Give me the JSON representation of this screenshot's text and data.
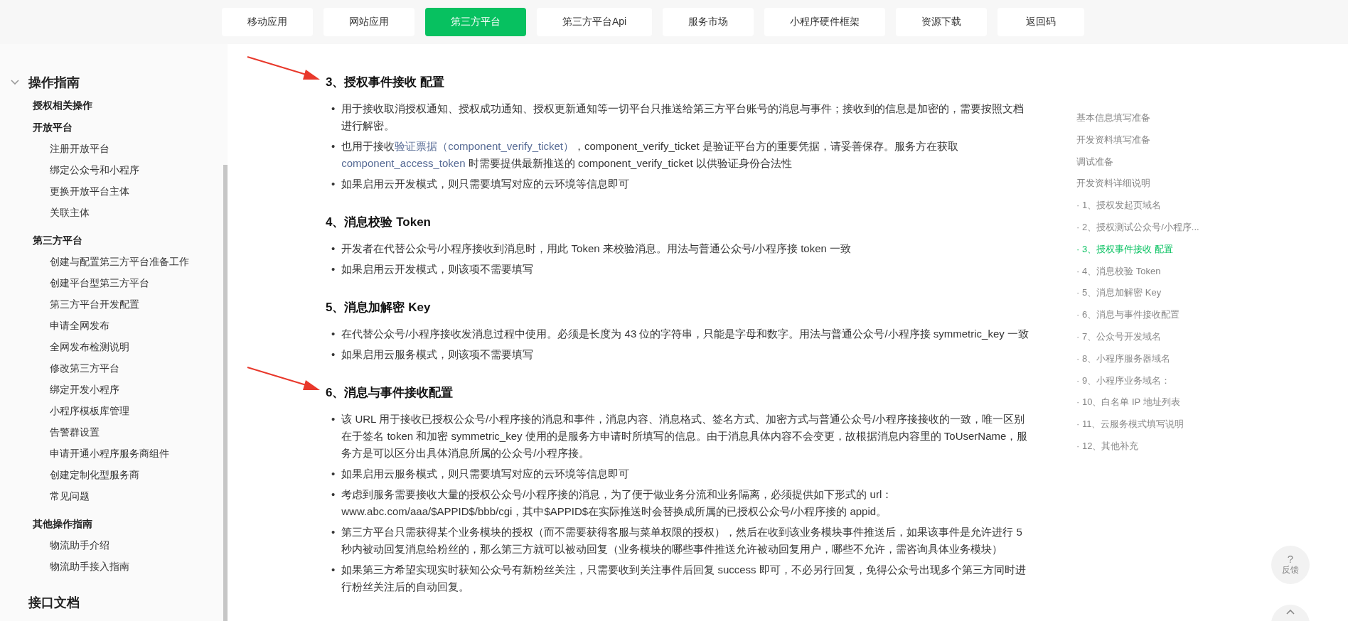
{
  "nav": [
    {
      "label": "移动应用",
      "selected": false
    },
    {
      "label": "网站应用",
      "selected": false
    },
    {
      "label": "第三方平台",
      "selected": true
    },
    {
      "label": "第三方平台Api",
      "selected": false
    },
    {
      "label": "服务市场",
      "selected": false
    },
    {
      "label": "小程序硬件框架",
      "selected": false
    },
    {
      "label": "资源下载",
      "selected": false
    },
    {
      "label": "返回码",
      "selected": false
    }
  ],
  "sidebar": {
    "sections": [
      {
        "title": "操作指南",
        "expanded": true,
        "groups": [
          {
            "title": "授权相关操作"
          },
          {
            "title": "开放平台",
            "items": [
              "注册开放平台",
              "绑定公众号和小程序",
              "更换开放平台主体",
              "关联主体"
            ]
          },
          {
            "title": "第三方平台",
            "items": [
              "创建与配置第三方平台准备工作",
              "创建平台型第三方平台",
              "第三方平台开发配置",
              "申请全网发布",
              "全网发布检测说明",
              "修改第三方平台",
              "绑定开发小程序",
              "小程序模板库管理",
              "告警群设置",
              "申请开通小程序服务商组件",
              "创建定制化型服务商",
              "常见问题"
            ]
          },
          {
            "title": "其他操作指南",
            "items": [
              "物流助手介绍",
              "物流助手接入指南"
            ]
          }
        ]
      }
    ],
    "footer_section": "接口文档"
  },
  "content": {
    "sections": [
      {
        "heading": "3、授权事件接收 配置",
        "arrow": true,
        "bullets": [
          {
            "marker": "•",
            "parts": [
              {
                "text": "用于接收取消授权通知、授权成功通知、授权更新通知等一切平台只推送给第三方平台账号的消息与事件；接收到的信息是加密的，需要按照文档进行解密。",
                "link": false
              }
            ]
          },
          {
            "marker": "•",
            "parts": [
              {
                "text": "也用于接收",
                "link": false
              },
              {
                "text": "验证票据（component_verify_ticket）",
                "link": true
              },
              {
                "text": "，component_verify_ticket 是验证平台方的重要凭据，请妥善保存。服务方在获取 ",
                "link": false
              },
              {
                "text": "component_access_token",
                "link": true
              },
              {
                "text": " 时需要提供最新推送的 component_verify_ticket 以供验证身份合法性",
                "link": false
              }
            ]
          },
          {
            "marker": "•",
            "parts": [
              {
                "text": "如果启用云开发模式，则只需要填写对应的云环境等信息即可",
                "link": false
              }
            ]
          }
        ]
      },
      {
        "heading": "4、消息校验 Token",
        "arrow": false,
        "bullets": [
          {
            "marker": "•",
            "parts": [
              {
                "text": "开发者在代替公众号/小程序接收到消息时，用此 Token 来校验消息。用法与普通公众号/小程序接 token 一致",
                "link": false
              }
            ]
          },
          {
            "marker": "•",
            "parts": [
              {
                "text": "如果启用云开发模式，则该项不需要填写",
                "link": false
              }
            ]
          }
        ]
      },
      {
        "heading": "5、消息加解密 Key",
        "arrow": false,
        "bullets": [
          {
            "marker": "•",
            "parts": [
              {
                "text": "在代替公众号/小程序接收发消息过程中使用。必须是长度为 43 位的字符串，只能是字母和数字。用法与普通公众号/小程序接 symmetric_key 一致",
                "link": false
              }
            ]
          },
          {
            "marker": "•",
            "parts": [
              {
                "text": "如果启用云服务模式，则该项不需要填写",
                "link": false
              }
            ]
          }
        ]
      },
      {
        "heading": "6、消息与事件接收配置",
        "arrow": true,
        "bullets": [
          {
            "marker": "•",
            "parts": [
              {
                "text": "该 URL 用于接收已授权公众号/小程序接的消息和事件，消息内容、消息格式、签名方式、加密方式与普通公众号/小程序接接收的一致，唯一区别在于签名 token 和加密 symmetric_key 使用的是服务方申请时所填写的信息。由于消息具体内容不会变更，故根据消息内容里的 ToUserName，服务方是可以区分出具体消息所属的公众号/小程序接。",
                "link": false
              }
            ]
          },
          {
            "marker": "•",
            "parts": [
              {
                "text": "如果启用云服务模式，则只需要填写对应的云环境等信息即可",
                "link": false
              }
            ]
          },
          {
            "marker": "•",
            "parts": [
              {
                "text": "考虑到服务需要接收大量的授权公众号/小程序接的消息，为了便于做业务分流和业务隔离，必须提供如下形式的 url：www.abc.com/aaa/$APPID$/bbb/cgi，其中$APPID$在实际推送时会替换成所属的已授权公众号/小程序接的 appid。",
                "link": false
              }
            ]
          },
          {
            "marker": "•",
            "parts": [
              {
                "text": "第三方平台只需获得某个业务模块的授权（而不需要获得客服与菜单权限的授权），然后在收到该业务模块事件推送后，如果该事件是允许进行 5 秒内被动回复消息给粉丝的，那么第三方就可以被动回复（业务模块的哪些事件推送允许被动回复用户，哪些不允许，需咨询具体业务模块）",
                "link": false
              }
            ]
          },
          {
            "marker": "•",
            "parts": [
              {
                "text": "如果第三方希望实现实时获知公众号有新粉丝关注，只需要收到关注事件后回复 success 即可，不必另行回复，免得公众号出现多个第三方同时进行粉丝关注后的自动回复。",
                "link": false
              }
            ]
          }
        ]
      }
    ]
  },
  "toc": [
    {
      "label": "基本信息填写准备",
      "selected": false
    },
    {
      "label": "开发资料填写准备",
      "selected": false
    },
    {
      "label": "调试准备",
      "selected": false
    },
    {
      "label": "开发资料详细说明",
      "selected": false
    },
    {
      "label": "· 1、授权发起页域名",
      "selected": false
    },
    {
      "label": "· 2、授权测试公众号/小程序...",
      "selected": false
    },
    {
      "label": "· 3、授权事件接收 配置",
      "selected": true
    },
    {
      "label": "· 4、消息校验 Token",
      "selected": false
    },
    {
      "label": "· 5、消息加解密 Key",
      "selected": false
    },
    {
      "label": "· 6、消息与事件接收配置",
      "selected": false
    },
    {
      "label": "· 7、公众号开发域名",
      "selected": false
    },
    {
      "label": "· 8、小程序服务器域名",
      "selected": false
    },
    {
      "label": "· 9、小程序业务域名：",
      "selected": false
    },
    {
      "label": "· 10、白名单 IP 地址列表",
      "selected": false
    },
    {
      "label": "· 11、云服务模式填写说明",
      "selected": false
    },
    {
      "label": "· 12、其他补充",
      "selected": false
    }
  ],
  "feedback": {
    "icon": "?",
    "label": "反馈"
  }
}
